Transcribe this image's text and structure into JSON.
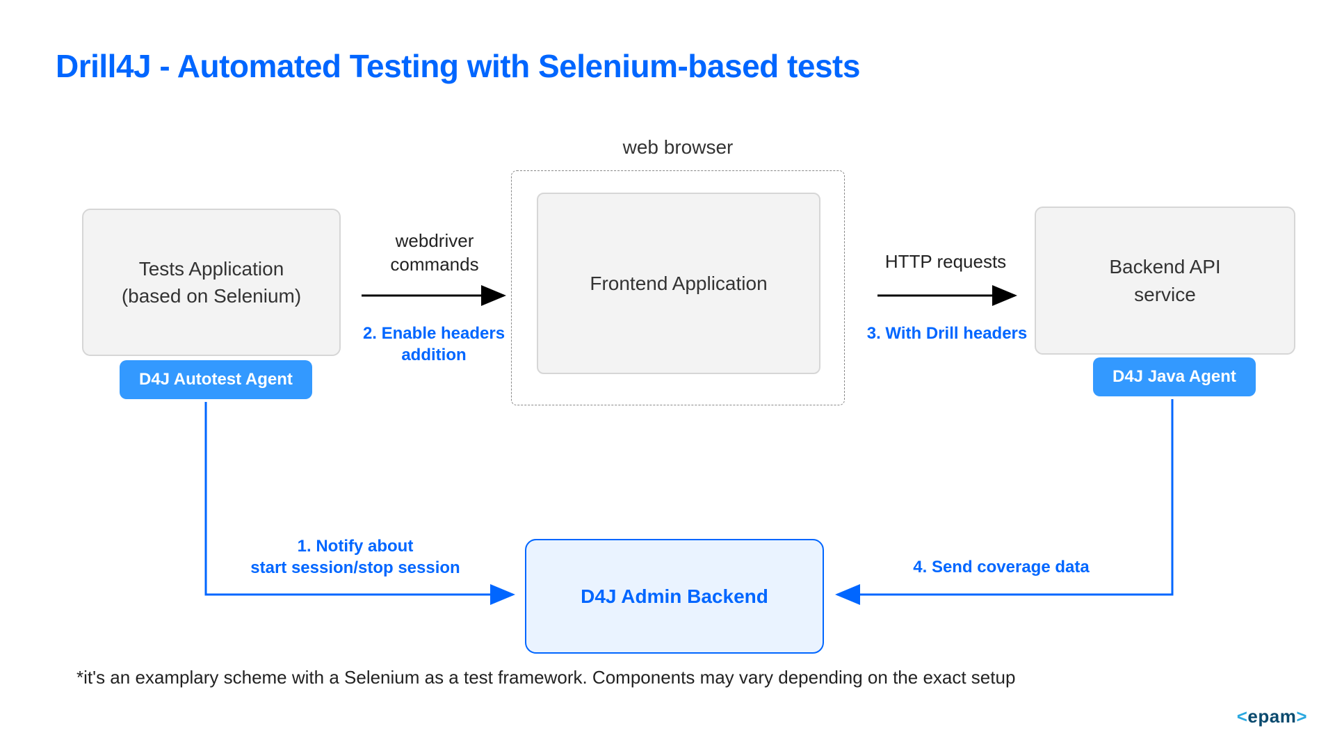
{
  "title": "Drill4J - Automated Testing with Selenium-based tests",
  "webBrowserLabel": "web browser",
  "nodes": {
    "tests": {
      "line1": "Tests Application",
      "line2": "(based on Selenium)"
    },
    "frontend": {
      "label": "Frontend Application"
    },
    "backend": {
      "line1": "Backend API",
      "line2": "service"
    },
    "admin": {
      "label": "D4J Admin Backend"
    }
  },
  "tags": {
    "autotest": "D4J Autotest Agent",
    "javaAgent": "D4J Java Agent"
  },
  "arrows": {
    "a1_top": "webdriver",
    "a1_top2": "commands",
    "a1_blue": "2. Enable headers",
    "a1_blue2": "addition",
    "a2_top": "HTTP requests",
    "a2_blue": "3. With Drill headers",
    "a3_blue": "1. Notify about",
    "a3_blue2": "start session/stop session",
    "a4_blue": "4. Send coverage data"
  },
  "footnote": "*it's an examplary scheme with a Selenium as a test framework. Components may vary depending on the exact setup",
  "logo": "epam"
}
